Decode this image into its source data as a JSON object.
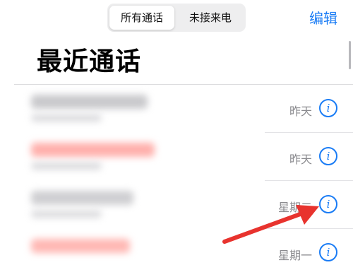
{
  "header": {
    "tabs": [
      {
        "label": "所有通话",
        "selected": true
      },
      {
        "label": "未接来电",
        "selected": false
      }
    ],
    "edit_label": "编辑"
  },
  "title": "最近通话",
  "calls": [
    {
      "date": "昨天",
      "missed": false,
      "info_icon": "info-circle-icon"
    },
    {
      "date": "昨天",
      "missed": true,
      "info_icon": "info-circle-icon"
    },
    {
      "date": "星期二",
      "missed": false,
      "info_icon": "info-circle-icon"
    },
    {
      "date": "星期一",
      "missed": true,
      "info_icon": "info-circle-icon"
    }
  ],
  "colors": {
    "accent": "#1a7cf5",
    "missed": "#ff3b30",
    "annotation_arrow": "#e8332e"
  }
}
